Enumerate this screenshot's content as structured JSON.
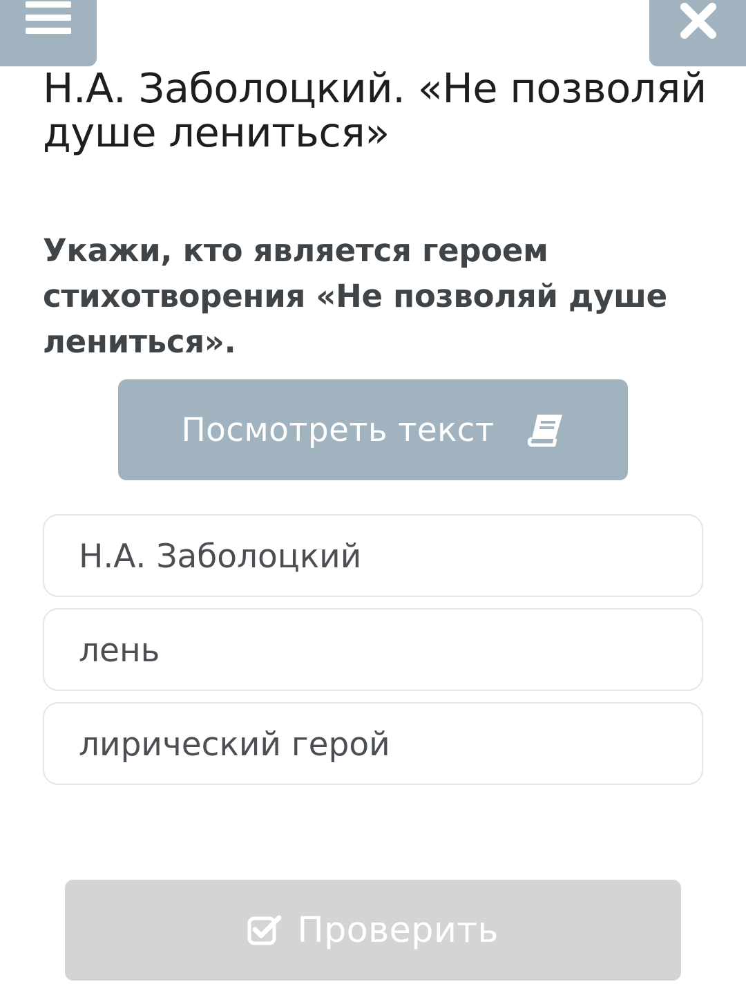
{
  "header": {
    "menu_icon": "hamburger-menu-icon",
    "close_icon": "close-icon"
  },
  "title": "Н.А. Заболоцкий. «Не позволяй душе лениться»",
  "question": "Укажи, кто является героем стихотворения «Не позволяй душе лениться».",
  "view_text_button": {
    "label": "Посмотреть текст",
    "icon": "book-icon"
  },
  "options": [
    {
      "label": "Н.А. Заболоцкий"
    },
    {
      "label": "лень"
    },
    {
      "label": "лирический герой"
    }
  ],
  "check_button": {
    "label": "Проверить",
    "icon": "checkbox-check-icon"
  },
  "colors": {
    "accent": "#a0b3bf",
    "disabled_button": "#d4d4d4",
    "question_text": "#3f4449",
    "option_border": "#e2e6e8"
  }
}
